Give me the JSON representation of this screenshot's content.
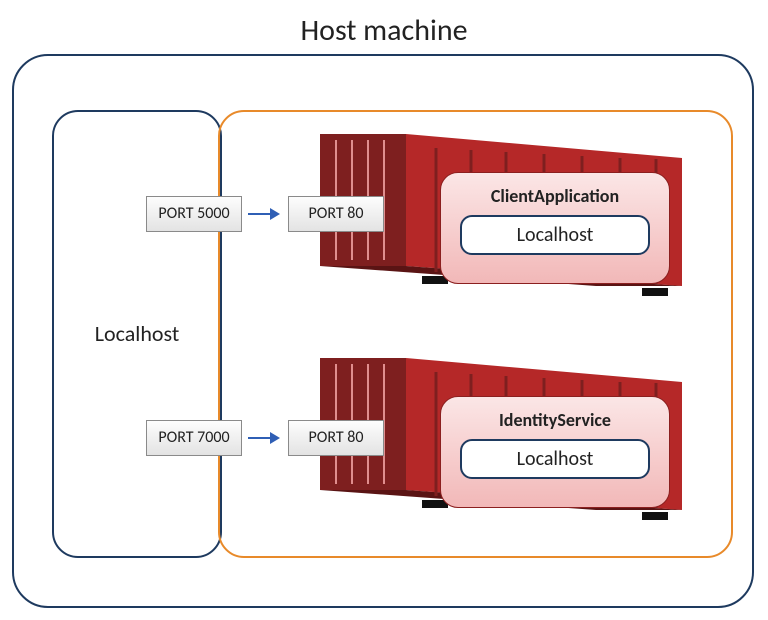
{
  "title": "Host machine",
  "leftColumnLabel": "Localhost",
  "containers": [
    {
      "hostPort": "PORT 5000",
      "containerPort": "PORT 80",
      "appName": "ClientApplication",
      "appLocal": "Localhost"
    },
    {
      "hostPort": "PORT 7000",
      "containerPort": "PORT 80",
      "appName": "IdentityService",
      "appLocal": "Localhost"
    }
  ]
}
